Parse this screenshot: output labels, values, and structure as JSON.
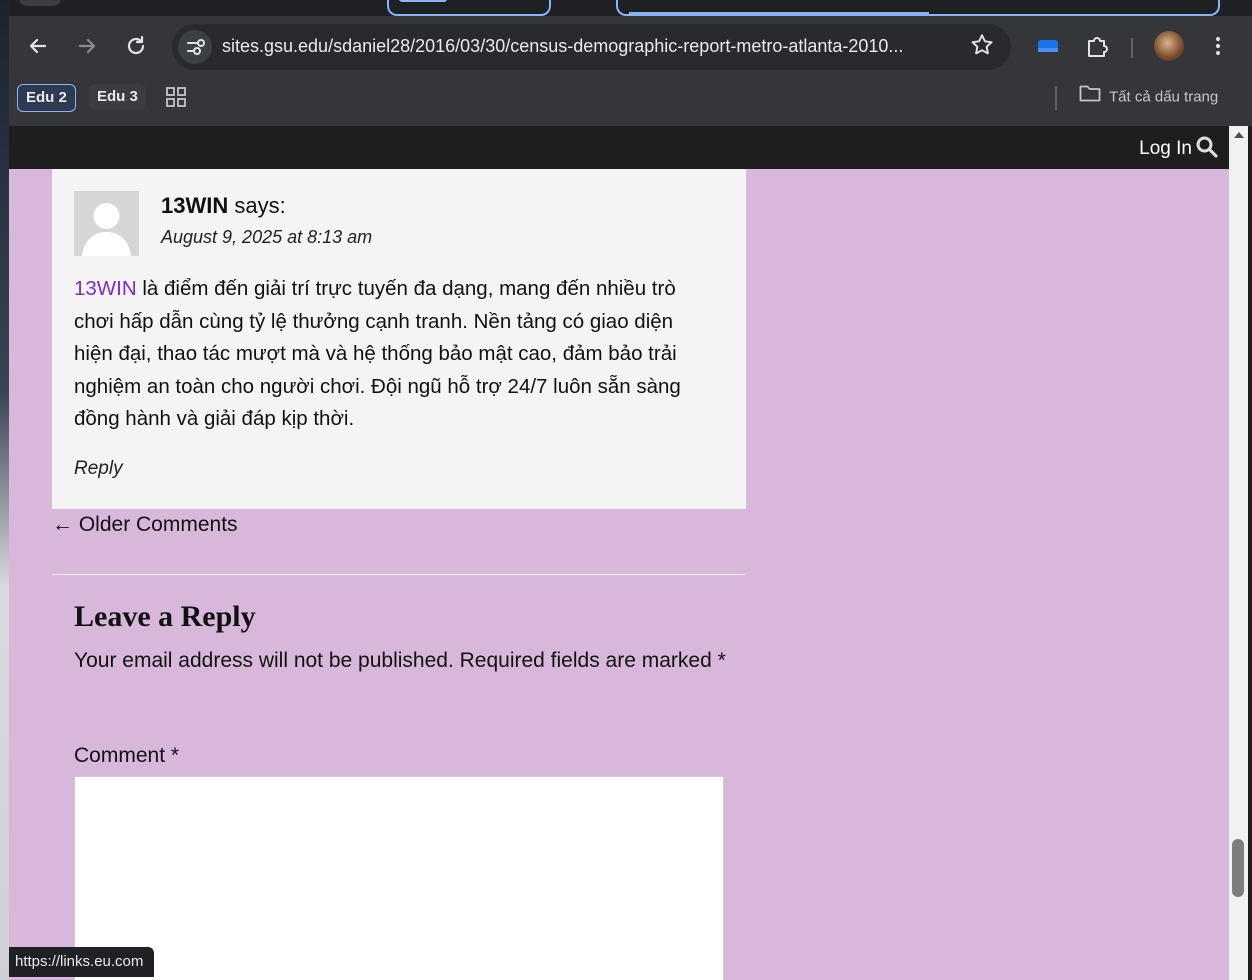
{
  "browser": {
    "url": "sites.gsu.edu/sdaniel28/2016/03/30/census-demographic-report-metro-atlanta-2010...",
    "bookmarks": [
      {
        "label": "Edu 2"
      },
      {
        "label": "Edu 3"
      }
    ],
    "all_bookmarks_label": "Tất cả dấu trang",
    "status_link": "https://links.eu.com"
  },
  "admin_bar": {
    "login_label": "Log In"
  },
  "comment": {
    "author": "13WIN",
    "says": "says:",
    "date": "August 9, 2025 at 8:13 am",
    "link_text": "13WIN",
    "body": " là điểm đến giải trí trực tuyến đa dạng, mang đến nhiều trò chơi hấp dẫn cùng tỷ lệ thưởng cạnh tranh. Nền tảng có giao diện hiện đại, thao tác mượt mà và hệ thống bảo mật cao, đảm bảo trải nghiệm an toàn cho người chơi. Đội ngũ hỗ trợ 24/7 luôn sẵn sàng đồng hành và giải đáp kịp thời.",
    "reply_label": "Reply"
  },
  "nav": {
    "older_comments": "← Older Comments"
  },
  "reply_form": {
    "title": "Leave a Reply",
    "notes": "Your email address will not be published. Required fields are marked *",
    "comment_label": "Comment *"
  },
  "colors": {
    "page_bg": "#d7b8da",
    "link": "#7b2ec7",
    "chrome_bg": "#35363a"
  }
}
